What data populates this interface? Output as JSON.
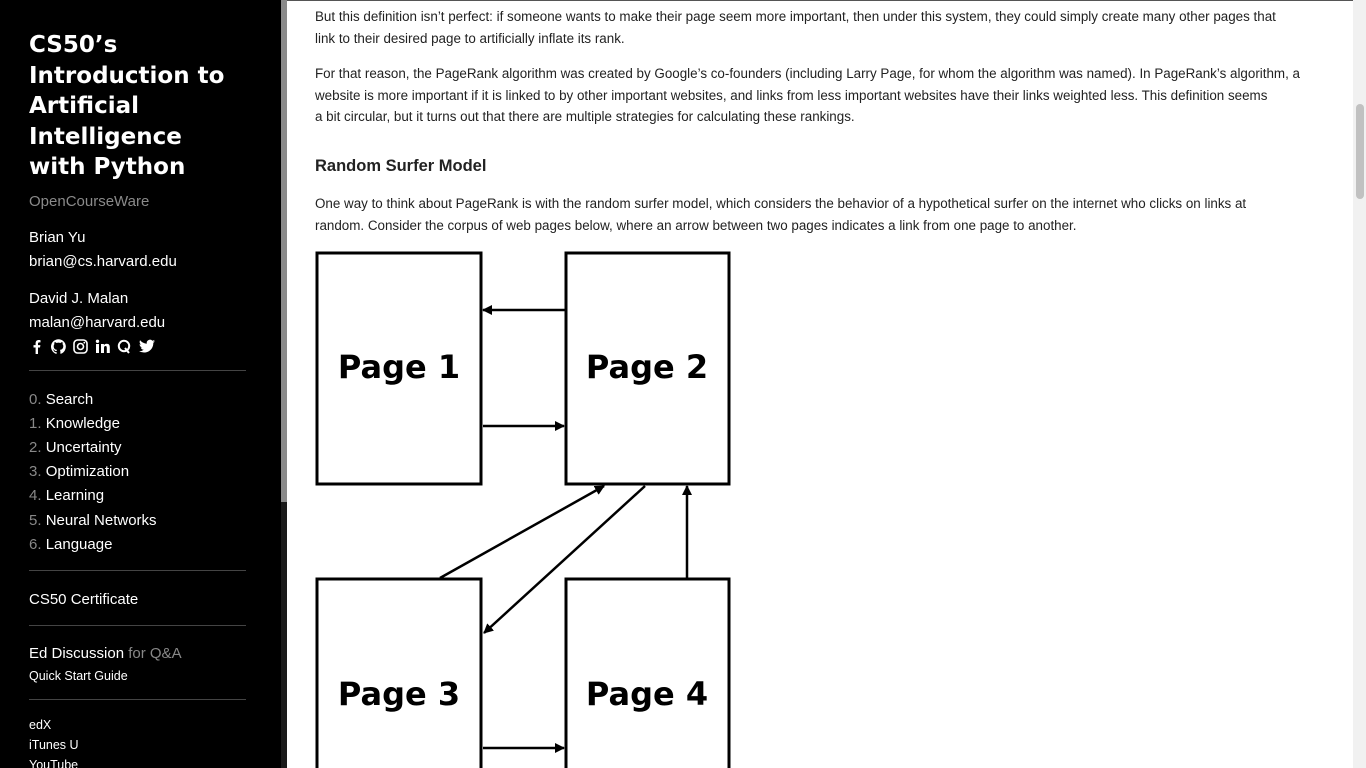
{
  "sidebar": {
    "title": "CS50’s Introduction to Artificial Intelligence with Python",
    "subtitle": "OpenCourseWare",
    "instructors": [
      {
        "name": "Brian Yu",
        "email": "brian@cs.harvard.edu"
      },
      {
        "name": "David J. Malan",
        "email": "malan@harvard.edu"
      }
    ],
    "social_icons": [
      "facebook-icon",
      "github-icon",
      "instagram-icon",
      "linkedin-icon",
      "quora-icon",
      "twitter-icon"
    ],
    "lectures": [
      {
        "num": "0.",
        "label": "Search"
      },
      {
        "num": "1.",
        "label": "Knowledge"
      },
      {
        "num": "2.",
        "label": "Uncertainty"
      },
      {
        "num": "3.",
        "label": "Optimization"
      },
      {
        "num": "4.",
        "label": "Learning"
      },
      {
        "num": "5.",
        "label": "Neural Networks"
      },
      {
        "num": "6.",
        "label": "Language"
      }
    ],
    "certificate": "CS50 Certificate",
    "ed_discussion": "Ed Discussion",
    "ed_suffix": "for Q&A",
    "quick_start": "Quick Start Guide",
    "platforms": [
      "edX",
      "iTunes U",
      "YouTube"
    ]
  },
  "content": {
    "para1_line1": "But this definition isn’t perfect: if someone wants to make their page seem more important, then under this system, they could simply create many other pages that",
    "para1_line2": "link to their desired page to artificially inflate its rank.",
    "para2_line1": "For that reason, the PageRank algorithm was created by Google’s co-founders (including Larry Page, for whom the algorithm was named). In PageRank’s algorithm, a",
    "para2_line2": "website is more important if it is linked to by other important websites, and links from less important websites have their links weighted less. This definition seems",
    "para2_line3": "a bit circular, but it turns out that there are multiple strategies for calculating these rankings.",
    "heading": "Random Surfer Model",
    "para3_line1": "One way to think about PageRank is with the random surfer model, which considers the behavior of a hypothetical surfer on the internet who clicks on links at",
    "para3_line2": "random. Consider the corpus of web pages below, where an arrow between two pages indicates a link from one page to another."
  },
  "diagram": {
    "pages": [
      "Page 1",
      "Page 2",
      "Page 3",
      "Page 4"
    ]
  }
}
